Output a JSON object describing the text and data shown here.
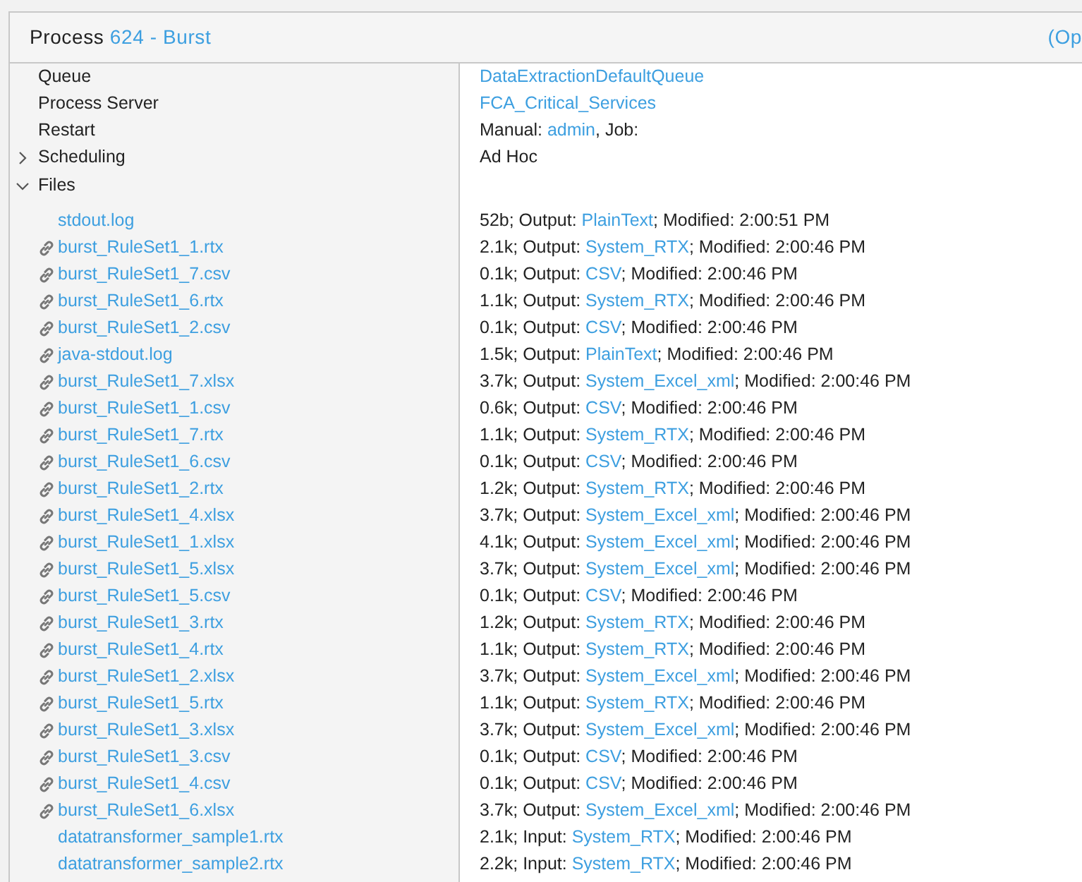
{
  "header": {
    "label": "Process",
    "link": "624 - Burst",
    "right_link": "(Op"
  },
  "properties": [
    {
      "kind": "property",
      "label": "Queue",
      "value": [
        {
          "link": "DataExtractionDefaultQueue"
        }
      ]
    },
    {
      "kind": "property",
      "label": "Process Server",
      "value": [
        {
          "link": "FCA_Critical_Services"
        }
      ]
    },
    {
      "kind": "property",
      "label": "Restart",
      "value": [
        {
          "text": "Manual: "
        },
        {
          "link": "admin"
        },
        {
          "text": ", Job:"
        }
      ]
    },
    {
      "kind": "group",
      "label": "Scheduling",
      "expanded": false,
      "value": [
        {
          "text": "Ad Hoc"
        }
      ]
    },
    {
      "kind": "group",
      "label": "Files",
      "expanded": true,
      "children": [
        {
          "name": "stdout.log",
          "linked": false,
          "detail": [
            {
              "text": "52b; Output: "
            },
            {
              "link": "PlainText"
            },
            {
              "text": "; Modified: 2:00:51 PM"
            }
          ]
        },
        {
          "name": "burst_RuleSet1_1.rtx",
          "linked": true,
          "detail": [
            {
              "text": "2.1k; Output: "
            },
            {
              "link": "System_RTX"
            },
            {
              "text": "; Modified: 2:00:46 PM"
            }
          ]
        },
        {
          "name": "burst_RuleSet1_7.csv",
          "linked": true,
          "detail": [
            {
              "text": "0.1k; Output: "
            },
            {
              "link": "CSV"
            },
            {
              "text": "; Modified: 2:00:46 PM"
            }
          ]
        },
        {
          "name": "burst_RuleSet1_6.rtx",
          "linked": true,
          "detail": [
            {
              "text": "1.1k; Output: "
            },
            {
              "link": "System_RTX"
            },
            {
              "text": "; Modified: 2:00:46 PM"
            }
          ]
        },
        {
          "name": "burst_RuleSet1_2.csv",
          "linked": true,
          "detail": [
            {
              "text": "0.1k; Output: "
            },
            {
              "link": "CSV"
            },
            {
              "text": "; Modified: 2:00:46 PM"
            }
          ]
        },
        {
          "name": "java-stdout.log",
          "linked": true,
          "detail": [
            {
              "text": "1.5k; Output: "
            },
            {
              "link": "PlainText"
            },
            {
              "text": "; Modified: 2:00:46 PM"
            }
          ]
        },
        {
          "name": "burst_RuleSet1_7.xlsx",
          "linked": true,
          "detail": [
            {
              "text": "3.7k; Output: "
            },
            {
              "link": "System_Excel_xml"
            },
            {
              "text": "; Modified: 2:00:46 PM"
            }
          ]
        },
        {
          "name": "burst_RuleSet1_1.csv",
          "linked": true,
          "detail": [
            {
              "text": "0.6k; Output: "
            },
            {
              "link": "CSV"
            },
            {
              "text": "; Modified: 2:00:46 PM"
            }
          ]
        },
        {
          "name": "burst_RuleSet1_7.rtx",
          "linked": true,
          "detail": [
            {
              "text": "1.1k; Output: "
            },
            {
              "link": "System_RTX"
            },
            {
              "text": "; Modified: 2:00:46 PM"
            }
          ]
        },
        {
          "name": "burst_RuleSet1_6.csv",
          "linked": true,
          "detail": [
            {
              "text": "0.1k; Output: "
            },
            {
              "link": "CSV"
            },
            {
              "text": "; Modified: 2:00:46 PM"
            }
          ]
        },
        {
          "name": "burst_RuleSet1_2.rtx",
          "linked": true,
          "detail": [
            {
              "text": "1.2k; Output: "
            },
            {
              "link": "System_RTX"
            },
            {
              "text": "; Modified: 2:00:46 PM"
            }
          ]
        },
        {
          "name": "burst_RuleSet1_4.xlsx",
          "linked": true,
          "detail": [
            {
              "text": "3.7k; Output: "
            },
            {
              "link": "System_Excel_xml"
            },
            {
              "text": "; Modified: 2:00:46 PM"
            }
          ]
        },
        {
          "name": "burst_RuleSet1_1.xlsx",
          "linked": true,
          "detail": [
            {
              "text": "4.1k; Output: "
            },
            {
              "link": "System_Excel_xml"
            },
            {
              "text": "; Modified: 2:00:46 PM"
            }
          ]
        },
        {
          "name": "burst_RuleSet1_5.xlsx",
          "linked": true,
          "detail": [
            {
              "text": "3.7k; Output: "
            },
            {
              "link": "System_Excel_xml"
            },
            {
              "text": "; Modified: 2:00:46 PM"
            }
          ]
        },
        {
          "name": "burst_RuleSet1_5.csv",
          "linked": true,
          "detail": [
            {
              "text": "0.1k; Output: "
            },
            {
              "link": "CSV"
            },
            {
              "text": "; Modified: 2:00:46 PM"
            }
          ]
        },
        {
          "name": "burst_RuleSet1_3.rtx",
          "linked": true,
          "detail": [
            {
              "text": "1.2k; Output: "
            },
            {
              "link": "System_RTX"
            },
            {
              "text": "; Modified: 2:00:46 PM"
            }
          ]
        },
        {
          "name": "burst_RuleSet1_4.rtx",
          "linked": true,
          "detail": [
            {
              "text": "1.1k; Output: "
            },
            {
              "link": "System_RTX"
            },
            {
              "text": "; Modified: 2:00:46 PM"
            }
          ]
        },
        {
          "name": "burst_RuleSet1_2.xlsx",
          "linked": true,
          "detail": [
            {
              "text": "3.7k; Output: "
            },
            {
              "link": "System_Excel_xml"
            },
            {
              "text": "; Modified: 2:00:46 PM"
            }
          ]
        },
        {
          "name": "burst_RuleSet1_5.rtx",
          "linked": true,
          "detail": [
            {
              "text": "1.1k; Output: "
            },
            {
              "link": "System_RTX"
            },
            {
              "text": "; Modified: 2:00:46 PM"
            }
          ]
        },
        {
          "name": "burst_RuleSet1_3.xlsx",
          "linked": true,
          "detail": [
            {
              "text": "3.7k; Output: "
            },
            {
              "link": "System_Excel_xml"
            },
            {
              "text": "; Modified: 2:00:46 PM"
            }
          ]
        },
        {
          "name": "burst_RuleSet1_3.csv",
          "linked": true,
          "detail": [
            {
              "text": "0.1k; Output: "
            },
            {
              "link": "CSV"
            },
            {
              "text": "; Modified: 2:00:46 PM"
            }
          ]
        },
        {
          "name": "burst_RuleSet1_4.csv",
          "linked": true,
          "detail": [
            {
              "text": "0.1k; Output: "
            },
            {
              "link": "CSV"
            },
            {
              "text": "; Modified: 2:00:46 PM"
            }
          ]
        },
        {
          "name": "burst_RuleSet1_6.xlsx",
          "linked": true,
          "detail": [
            {
              "text": "3.7k; Output: "
            },
            {
              "link": "System_Excel_xml"
            },
            {
              "text": "; Modified: 2:00:46 PM"
            }
          ]
        },
        {
          "name": "datatransformer_sample1.rtx",
          "linked": false,
          "detail": [
            {
              "text": "2.1k; Input: "
            },
            {
              "link": "System_RTX"
            },
            {
              "text": "; Modified: 2:00:46 PM"
            }
          ]
        },
        {
          "name": "datatransformer_sample2.rtx",
          "linked": false,
          "detail": [
            {
              "text": "2.2k; Input: "
            },
            {
              "link": "System_RTX"
            },
            {
              "text": "; Modified: 2:00:46 PM"
            }
          ]
        }
      ]
    }
  ]
}
